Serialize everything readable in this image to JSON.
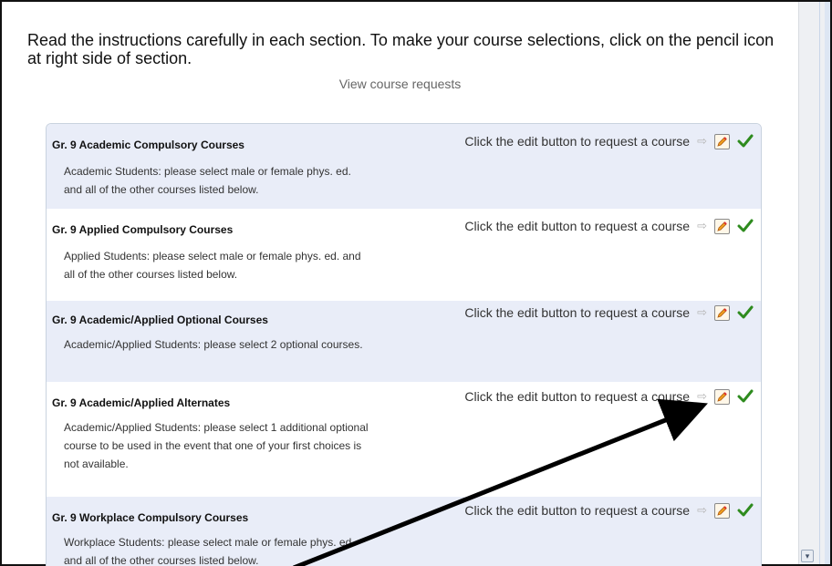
{
  "page": {
    "instructions": "Read the instructions carefully in each section. To make your course selections, click on the pencil icon at right side of section.",
    "view_requests_label": "View course requests"
  },
  "action_label": "Click the edit button to request a course",
  "sections": [
    {
      "title": "Gr. 9 Academic Compulsory Courses",
      "description": "Academic Students: please select male or female phys. ed. and all of the other courses listed below."
    },
    {
      "title": "Gr. 9 Applied Compulsory Courses",
      "description": "Applied Students: please select male or female phys. ed. and all of the other courses listed below."
    },
    {
      "title": "Gr. 9 Academic/Applied Optional Courses",
      "description": "Academic/Applied Students: please select 2 optional courses."
    },
    {
      "title": "Gr. 9 Academic/Applied Alternates",
      "description": "Academic/Applied Students: please select 1 additional optional course to be used in the event that one of your first choices is not available."
    },
    {
      "title": "Gr. 9 Workplace Compulsory Courses",
      "description": "Workplace Students: please select male or female phys. ed. and all of the other courses listed below."
    }
  ],
  "icons": {
    "edit": "pencil-icon",
    "status": "checkmark-icon",
    "arrow": "right-arrow-icon"
  },
  "colors": {
    "shaded_row": "#e9edf8",
    "checkmark": "#2e8b1e",
    "annotation_arrow": "#000000"
  }
}
